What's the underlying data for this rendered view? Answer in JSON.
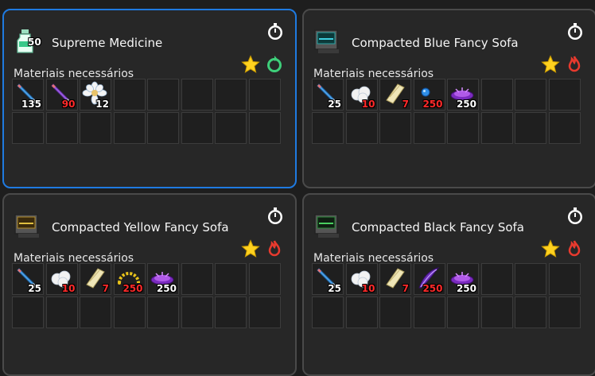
{
  "recipes": [
    {
      "title": "Supreme Medicine",
      "icon": "medicine-bottle-icon",
      "icon_count": "50",
      "subtitle": "Materiais necessários",
      "category_icon": "recycle-icon",
      "category_color": "#3ecf7a",
      "selected": true,
      "materials": [
        {
          "icon": "blue-pencil-icon",
          "qty": "135",
          "status": "ok"
        },
        {
          "icon": "purple-pencil-icon",
          "qty": "90",
          "status": "missing"
        },
        {
          "icon": "white-flower-icon",
          "qty": "12",
          "status": "ok"
        }
      ]
    },
    {
      "title": "Compacted Blue Fancy Sofa",
      "icon": "blue-sofa-icon",
      "subtitle": "Materiais necessários",
      "category_icon": "fire-icon",
      "category_color": "#e83a2e",
      "selected": false,
      "materials": [
        {
          "icon": "blue-pencil-icon",
          "qty": "25",
          "status": "ok"
        },
        {
          "icon": "cotton-icon",
          "qty": "10",
          "status": "missing"
        },
        {
          "icon": "paper-roll-icon",
          "qty": "7",
          "status": "missing"
        },
        {
          "icon": "blue-bead-icon",
          "qty": "250",
          "status": "missing"
        },
        {
          "icon": "purple-cushion-icon",
          "qty": "250",
          "status": "ok"
        }
      ]
    },
    {
      "title": "Compacted Yellow Fancy Sofa",
      "icon": "yellow-sofa-icon",
      "subtitle": "Materiais necessários",
      "category_icon": "fire-icon",
      "category_color": "#e83a2e",
      "selected": false,
      "materials": [
        {
          "icon": "blue-pencil-icon",
          "qty": "25",
          "status": "ok"
        },
        {
          "icon": "cotton-icon",
          "qty": "10",
          "status": "missing"
        },
        {
          "icon": "paper-roll-icon",
          "qty": "7",
          "status": "missing"
        },
        {
          "icon": "yellow-bead-arc-icon",
          "qty": "250",
          "status": "missing"
        },
        {
          "icon": "purple-cushion-icon",
          "qty": "250",
          "status": "ok"
        }
      ]
    },
    {
      "title": "Compacted Black Fancy Sofa",
      "icon": "black-sofa-icon",
      "subtitle": "Materiais necessários",
      "category_icon": "fire-icon",
      "category_color": "#e83a2e",
      "selected": false,
      "materials": [
        {
          "icon": "blue-pencil-icon",
          "qty": "25",
          "status": "ok"
        },
        {
          "icon": "cotton-icon",
          "qty": "10",
          "status": "missing"
        },
        {
          "icon": "paper-roll-icon",
          "qty": "7",
          "status": "missing"
        },
        {
          "icon": "purple-feather-icon",
          "qty": "250",
          "status": "missing"
        },
        {
          "icon": "purple-cushion-icon",
          "qty": "250",
          "status": "ok"
        }
      ]
    }
  ],
  "colors": {
    "selected_border": "#1f7ae0",
    "card_border": "#4a4a4a",
    "missing_qty": "#ff2a2a",
    "star": "#ffd21f"
  }
}
